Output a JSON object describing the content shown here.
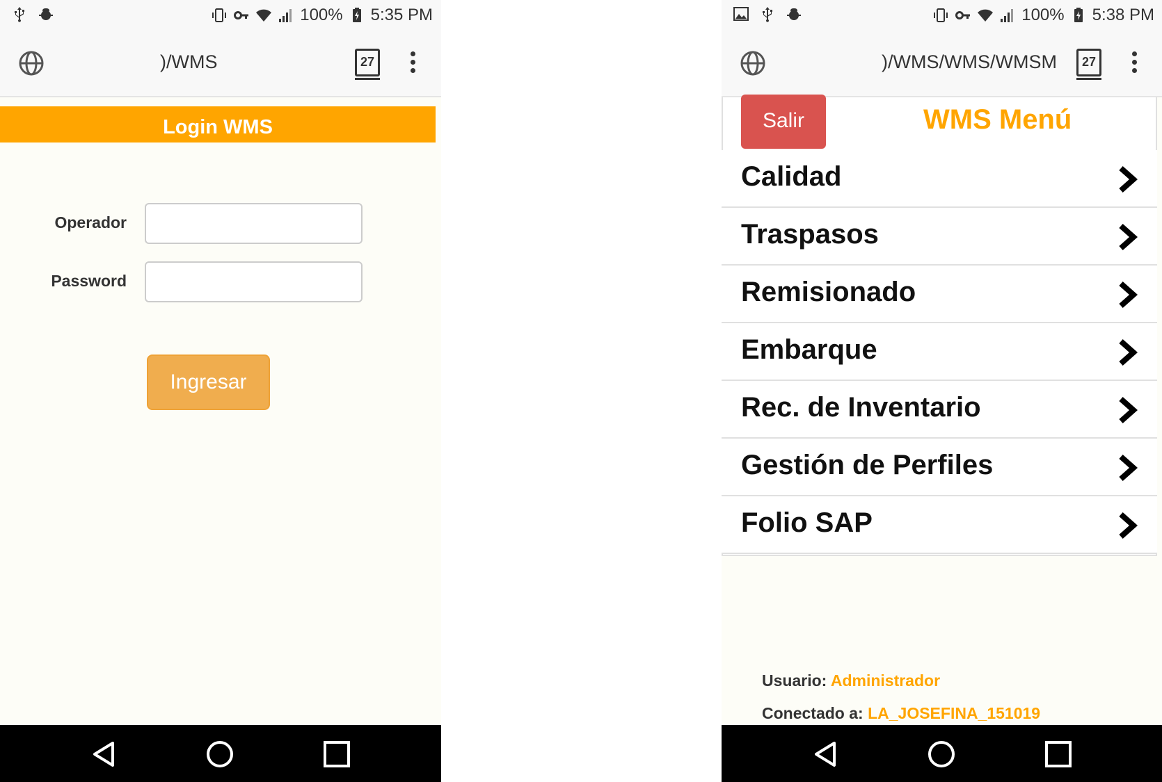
{
  "login_screen": {
    "status": {
      "battery": "100%",
      "time": "5:35 PM"
    },
    "address_bar": {
      "url": ")/WMS",
      "tab_count": "27"
    },
    "header": "Login WMS",
    "form": {
      "operador_label": "Operador",
      "password_label": "Password",
      "operador_value": "",
      "password_value": ""
    },
    "submit_label": "Ingresar"
  },
  "menu_screen": {
    "status": {
      "battery": "100%",
      "time": "5:38 PM"
    },
    "address_bar": {
      "url": ")/WMS/WMS/WMSM",
      "tab_count": "27"
    },
    "logout_label": "Salir",
    "title": "WMS Menú",
    "items": [
      {
        "label": "Calidad"
      },
      {
        "label": "Traspasos"
      },
      {
        "label": "Remisionado"
      },
      {
        "label": "Embarque"
      },
      {
        "label": "Rec. de Inventario"
      },
      {
        "label": "Gestión de Perfiles"
      },
      {
        "label": "Folio SAP"
      }
    ],
    "footer": {
      "user_label": "Usuario:",
      "user_value": "Administrador",
      "connected_label": "Conectado a:",
      "connected_value": "LA_JOSEFINA_151019"
    }
  },
  "colors": {
    "accent": "#ffa500",
    "button_warning": "#f0ad4e",
    "button_danger": "#d9534f",
    "page_bg": "#fdfdf7"
  }
}
